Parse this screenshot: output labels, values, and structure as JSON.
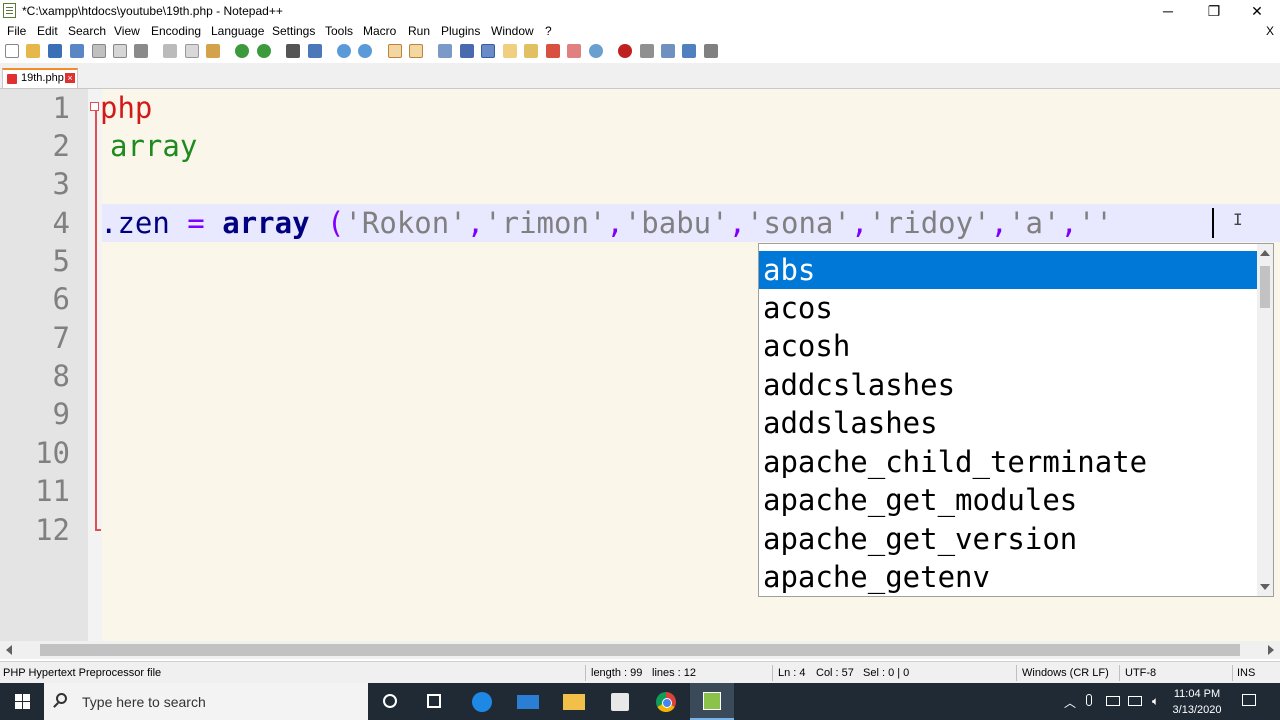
{
  "window": {
    "title": "*C:\\xampp\\htdocs\\youtube\\19th.php - Notepad++",
    "minimize_glyph": "─",
    "restore_glyph": "❐",
    "close_glyph": "✕"
  },
  "menu": {
    "items": [
      "File",
      "Edit",
      "Search",
      "View",
      "Encoding",
      "Language",
      "Settings",
      "Tools",
      "Macro",
      "Run",
      "Plugins",
      "Window",
      "?"
    ],
    "close_doc": "X"
  },
  "tab": {
    "label": "19th.php",
    "close_glyph": "×"
  },
  "editor": {
    "line_numbers": [
      "1",
      "2",
      "3",
      "4",
      "5",
      "6",
      "7",
      "8",
      "9",
      "10",
      "11",
      "12"
    ],
    "line1": "php",
    "line2": "array",
    "line4": {
      "ident": ".zen",
      "eq": " = ",
      "kw": "array",
      "open": " (",
      "s1": "'Rokon'",
      "s2": "'rimon'",
      "s3": "'babu'",
      "s4": "'sona'",
      "s5": "'ridoy'",
      "s6": "'a'",
      "s7": "''",
      "comma": ","
    },
    "ibeam_glyph": "I"
  },
  "autocomplete": {
    "items": [
      "abs",
      "acos",
      "acosh",
      "addcslashes",
      "addslashes",
      "apache_child_terminate",
      "apache_get_modules",
      "apache_get_version",
      "apache_getenv"
    ],
    "selected_index": 0
  },
  "status": {
    "file_type": "PHP Hypertext Preprocessor file",
    "length": "length : 99",
    "lines": "lines : 12",
    "ln": "Ln : 4",
    "col": "Col : 57",
    "sel": "Sel : 0 | 0",
    "eol": "Windows (CR LF)",
    "encoding": "UTF-8",
    "mode": "INS"
  },
  "taskbar": {
    "search_placeholder": "Type here to search",
    "time": "11:04 PM",
    "date": "3/13/2020"
  },
  "colors": {
    "selection": "#0078d7",
    "taskbar": "#1f2a35",
    "editor_bg": "#faf7ea"
  }
}
